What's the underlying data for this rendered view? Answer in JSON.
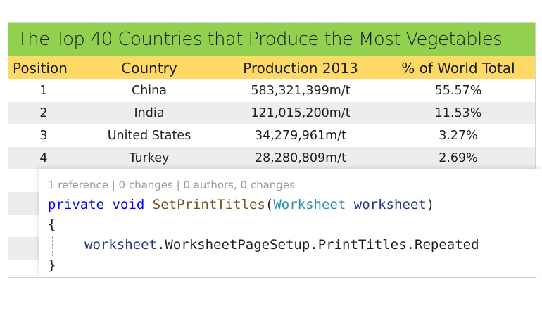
{
  "table": {
    "title": "The Top 40 Countries that Produce the Most Vegetables",
    "headers": [
      "Position",
      "Country",
      "Production 2013",
      "% of World Total"
    ],
    "rows": [
      {
        "position": "1",
        "country": "China",
        "production": "583,321,399m/t",
        "percent": "55.57%"
      },
      {
        "position": "2",
        "country": "India",
        "production": "121,015,200m/t",
        "percent": "11.53%"
      },
      {
        "position": "3",
        "country": "United States",
        "production": "34,279,961m/t",
        "percent": "3.27%"
      },
      {
        "position": "4",
        "country": "Turkey",
        "production": "28,280,809m/t",
        "percent": "2.69%"
      }
    ],
    "colors": {
      "title_bg": "#92d050",
      "header_bg": "#ffd966",
      "alt_row_bg": "#ededed"
    }
  },
  "code": {
    "codelens": "1 reference | 0 changes | 0 authors, 0 changes",
    "signature": {
      "kw_private": "private",
      "kw_void": "void",
      "method": "SetPrintTitles",
      "open_paren": "(",
      "type": "Worksheet",
      "param": "worksheet",
      "close_paren": ")"
    },
    "open_brace": "{",
    "body_line": {
      "object": "worksheet",
      "member_chain": ".WorksheetPageSetup.PrintTitles.Repeated"
    },
    "close_brace": "}"
  }
}
